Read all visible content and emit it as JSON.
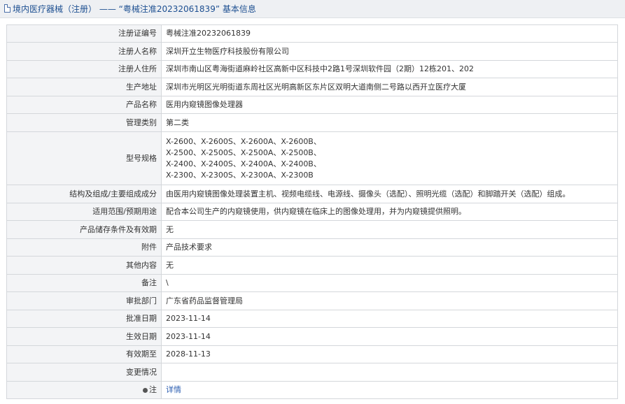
{
  "header": {
    "title": "境内医疗器械（注册） —— “粤械注准20232061839” 基本信息"
  },
  "rows": [
    {
      "label": "注册证编号",
      "value": "粤械注准20232061839"
    },
    {
      "label": "注册人名称",
      "value": "深圳开立生物医疗科技股份有限公司"
    },
    {
      "label": "注册人住所",
      "value": "深圳市南山区粤海街道麻岭社区高新中区科技中2路1号深圳软件园（2期）12栋201、202"
    },
    {
      "label": "生产地址",
      "value": "深圳市光明区光明街道东周社区光明高新区东片区双明大道南侧二号路以西开立医疗大厦"
    },
    {
      "label": "产品名称",
      "value": "医用内窥镜图像处理器"
    },
    {
      "label": "管理类别",
      "value": "第二类"
    },
    {
      "label": "型号规格",
      "lines": [
        "X-2600、X-2600S、X-2600A、X-2600B、",
        "X-2500、X-2500S、X-2500A、X-2500B、",
        "X-2400、X-2400S、X-2400A、X-2400B、",
        "X-2300、X-2300S、X-2300A、X-2300B"
      ]
    },
    {
      "label": "结构及组成/主要组成成分",
      "value": "由医用内窥镜图像处理装置主机、视频电缆线、电源线、摄像头（选配）、照明光缆（选配）和脚踏开关（选配）组成。"
    },
    {
      "label": "适用范围/预期用途",
      "value": "配合本公司生产的内窥镜使用，供内窥镜在临床上的图像处理用，并为内窥镜提供照明。"
    },
    {
      "label": "产品储存条件及有效期",
      "value": "无"
    },
    {
      "label": "附件",
      "value": "产品技术要求"
    },
    {
      "label": "其他内容",
      "value": "无"
    },
    {
      "label": "备注",
      "value": "\\"
    },
    {
      "label": "审批部门",
      "value": "广东省药品监督管理局"
    },
    {
      "label": "批准日期",
      "value": "2023-11-14"
    },
    {
      "label": "生效日期",
      "value": "2023-11-14"
    },
    {
      "label": "有效期至",
      "value": "2028-11-13"
    },
    {
      "label": "变更情况",
      "value": ""
    },
    {
      "label": "注",
      "value": "详情",
      "icon": "pin-icon"
    }
  ]
}
